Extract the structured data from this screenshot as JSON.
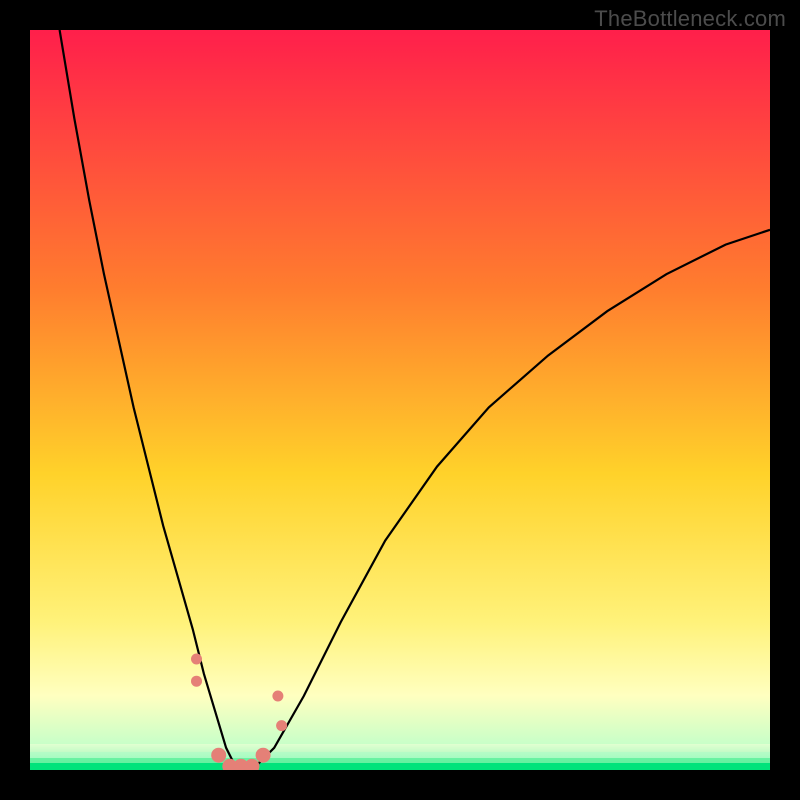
{
  "watermark": "TheBottleneck.com",
  "chart_data": {
    "type": "line",
    "title": "",
    "xlabel": "",
    "ylabel": "",
    "xlim": [
      0,
      100
    ],
    "ylim": [
      0,
      100
    ],
    "grid": false,
    "legend": false,
    "gradient_stops": [
      {
        "offset": 0,
        "color": "#ff1f4b"
      },
      {
        "offset": 0.35,
        "color": "#ff7d2e"
      },
      {
        "offset": 0.6,
        "color": "#ffd22a"
      },
      {
        "offset": 0.8,
        "color": "#fff27a"
      },
      {
        "offset": 0.9,
        "color": "#ffffc0"
      },
      {
        "offset": 0.965,
        "color": "#c8ffc8"
      },
      {
        "offset": 1.0,
        "color": "#00e37b"
      }
    ],
    "series": [
      {
        "name": "bottleneck-curve",
        "color": "#000000",
        "x": [
          4,
          6,
          8,
          10,
          12,
          14,
          16,
          18,
          20,
          22,
          23.5,
          25,
          26.5,
          28,
          30,
          33,
          37,
          42,
          48,
          55,
          62,
          70,
          78,
          86,
          94,
          100
        ],
        "y": [
          100,
          88,
          77,
          67,
          58,
          49,
          41,
          33,
          26,
          19,
          13,
          8,
          3,
          0,
          0,
          3,
          10,
          20,
          31,
          41,
          49,
          56,
          62,
          67,
          71,
          73
        ]
      }
    ],
    "markers": {
      "name": "highlight-points",
      "color": "#e58077",
      "radius_small": 5.5,
      "radius_large": 7.5,
      "points": [
        {
          "x": 22.5,
          "y": 15,
          "r": "small"
        },
        {
          "x": 22.5,
          "y": 12,
          "r": "small"
        },
        {
          "x": 25.5,
          "y": 2,
          "r": "large"
        },
        {
          "x": 27.0,
          "y": 0.5,
          "r": "large"
        },
        {
          "x": 28.5,
          "y": 0.5,
          "r": "large"
        },
        {
          "x": 30.0,
          "y": 0.5,
          "r": "large"
        },
        {
          "x": 31.5,
          "y": 2,
          "r": "large"
        },
        {
          "x": 33.5,
          "y": 10,
          "r": "small"
        },
        {
          "x": 34.0,
          "y": 6,
          "r": "small"
        }
      ]
    }
  }
}
